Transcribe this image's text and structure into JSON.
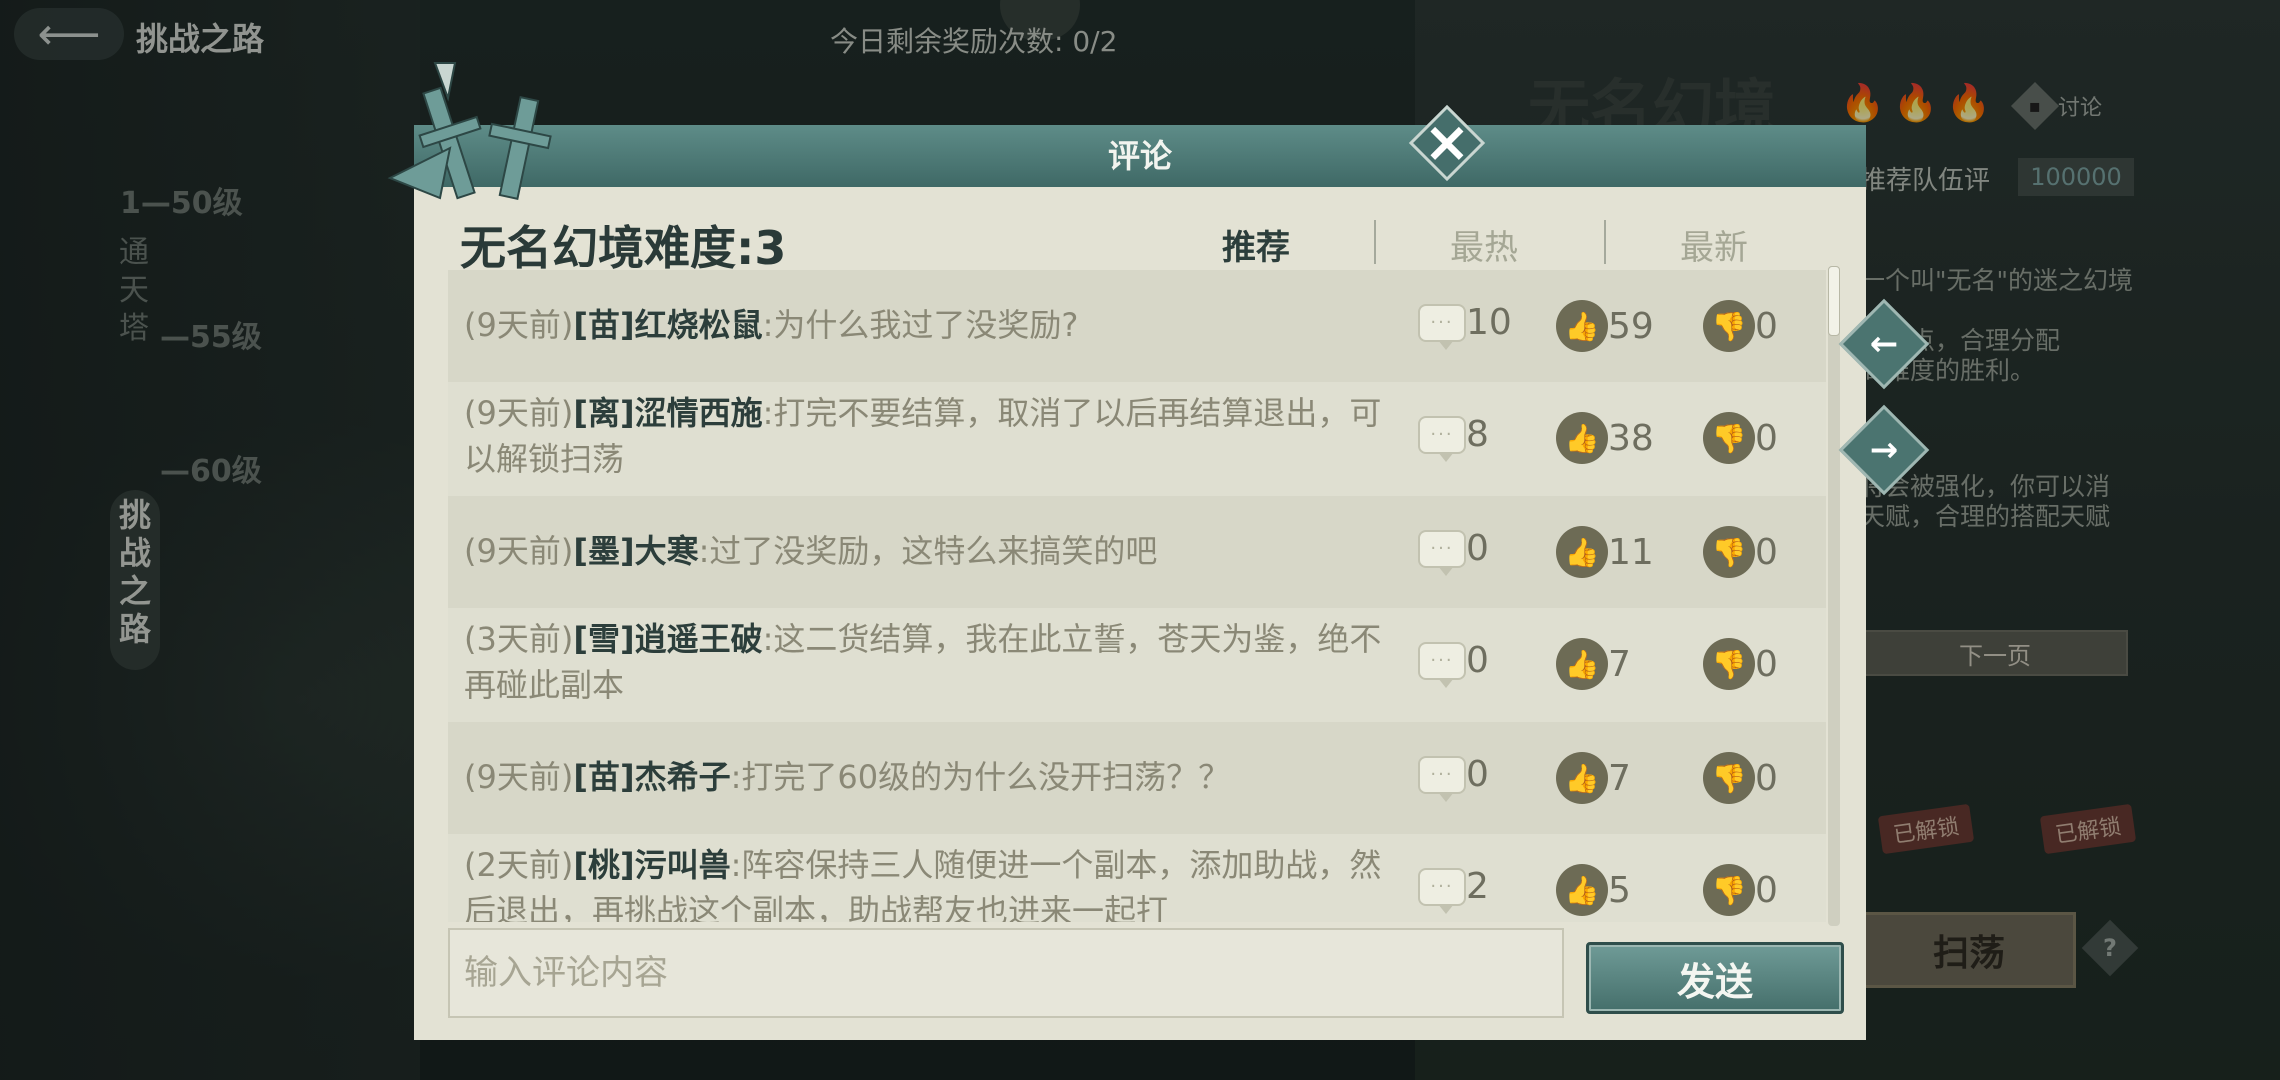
{
  "top_bar": {
    "page_title": "挑战之路",
    "reward_count": "今日剩余奖励次数: 0/2"
  },
  "left_list": {
    "levels": [
      "1—50级",
      "—55级",
      "—60级"
    ],
    "side_label": [
      "通",
      "天",
      "塔"
    ],
    "challenge_tab": [
      "挑",
      "战",
      "之",
      "路"
    ]
  },
  "right_panel": {
    "title": "无名幻境",
    "discuss_label": "讨论",
    "team_score_label": "推荐队伍评",
    "team_score": "100000",
    "desc_lines": [
      "一个叫\"无名\"的迷之幻境",
      "天赋点，合理分配",
      "高难度的胜利。",
      "将会被强化，你可以消",
      "天赋，合理的搭配天赋"
    ],
    "next_page": "下一页",
    "unlocked_label": "已解锁",
    "sweep_label": "扫荡",
    "help_label": "?"
  },
  "modal": {
    "title": "评论",
    "difficulty_title": "无名幻境难度:3",
    "sort_tabs": [
      {
        "label": "推荐",
        "active": true
      },
      {
        "label": "最热",
        "active": false
      },
      {
        "label": "最新",
        "active": false
      }
    ],
    "prev_arrow": "←",
    "next_arrow": "→",
    "input_placeholder": "输入评论内容",
    "send_label": "发送"
  },
  "comments": [
    {
      "time": "(9天前)",
      "user": "[苗]红烧松鼠",
      "text": ":为什么我过了没奖励?",
      "replies": "10",
      "likes": "59",
      "dislikes": "0"
    },
    {
      "time": "(9天前)",
      "user": "[离]涩情西施",
      "text": ":打完不要结算，取消了以后再结算退出，可以解锁扫荡",
      "replies": "8",
      "likes": "38",
      "dislikes": "0"
    },
    {
      "time": "(9天前)",
      "user": "[墨]大寒",
      "text": ":过了没奖励，这特么来搞笑的吧",
      "replies": "0",
      "likes": "11",
      "dislikes": "0"
    },
    {
      "time": "(3天前)",
      "user": "[雪]逍遥王破",
      "text": ":这二货结算，我在此立誓，苍天为鉴，绝不再碰此副本",
      "replies": "0",
      "likes": "7",
      "dislikes": "0"
    },
    {
      "time": "(9天前)",
      "user": "[苗]杰希子",
      "text": ":打完了60级的为什么没开扫荡？？",
      "replies": "0",
      "likes": "7",
      "dislikes": "0"
    },
    {
      "time": "(2天前)",
      "user": "[桃]污叫兽",
      "text": ":阵容保持三人随便进一个副本，添加助战，然后退出，再挑战这个副本，助战帮友也进来一起打",
      "replies": "2",
      "likes": "5",
      "dislikes": "0"
    }
  ],
  "colors": {
    "header_teal": "#4f7c78",
    "panel_bg": "#e3e2d4",
    "username": "#2c3e3b",
    "muted_text": "#8a8876"
  }
}
